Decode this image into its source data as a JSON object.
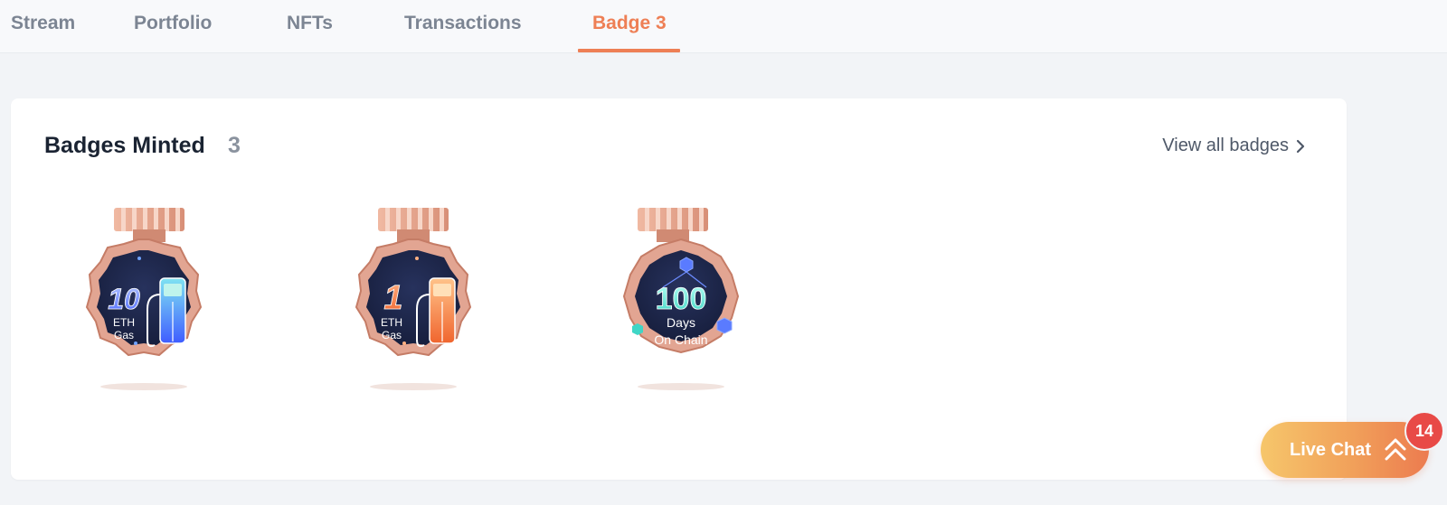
{
  "tabs": [
    {
      "label": "Stream"
    },
    {
      "label": "Portfolio"
    },
    {
      "label": "NFTs"
    },
    {
      "label": "Transactions"
    },
    {
      "label": "Badge 3",
      "active": true
    }
  ],
  "badges_section": {
    "title": "Badges Minted",
    "count": "3",
    "view_all_label": "View all badges",
    "badges": [
      {
        "number": "10",
        "line1": "ETH",
        "line2": "Gas",
        "icon": "fuel-pump-icon",
        "accent": "#4f7bff"
      },
      {
        "number": "1",
        "line1": "ETH",
        "line2": "Gas",
        "icon": "fuel-pump-icon",
        "accent": "#f07a3e"
      },
      {
        "number": "100",
        "line1": "Days",
        "line2": "On Chain",
        "icon": "cube-icon",
        "accent": "#3fd6c6"
      }
    ]
  },
  "live_chat": {
    "label": "Live Chat",
    "unread_count": "14"
  },
  "colors": {
    "accent": "#ee7f55",
    "badge_bronze": "#d99b85",
    "badge_face": "#1b2447",
    "notification": "#e84a47"
  }
}
